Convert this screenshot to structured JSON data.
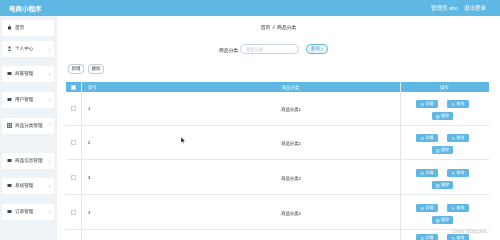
{
  "header": {
    "title": "电商小程序",
    "admin_text": "管理员 abo",
    "logout_label": "退出登录"
  },
  "sidebar": {
    "items": [
      {
        "label": "首页",
        "icon": "home-icon"
      },
      {
        "label": "个人中心",
        "icon": "user-icon"
      },
      {
        "label": "商家管理",
        "icon": "store-icon"
      },
      {
        "label": "用户管理",
        "icon": "users-icon"
      },
      {
        "label": "商品分类管理",
        "icon": "category-icon"
      },
      {
        "label": "商品信息管理",
        "icon": "goods-icon"
      },
      {
        "label": "系统管理",
        "icon": "settings-icon"
      },
      {
        "label": "订单管理",
        "icon": "order-icon"
      }
    ],
    "active_sub": "商品分类"
  },
  "breadcrumb": {
    "home": "首页",
    "sep": "//",
    "current": "商品分类"
  },
  "search": {
    "label": "商品分类",
    "placeholder": "商品分类",
    "button_label": "查询"
  },
  "toolbar": {
    "add_label": "新增",
    "delete_label": "删除"
  },
  "table": {
    "headers": {
      "index": "索引",
      "name": "商品分类",
      "ops": "操作"
    },
    "rows": [
      {
        "index": "1",
        "name": "商品分类1"
      },
      {
        "index": "2",
        "name": "商品分类2"
      },
      {
        "index": "3",
        "name": "商品分类3"
      },
      {
        "index": "4",
        "name": "商品分类4"
      }
    ],
    "actions": {
      "detail": "详情",
      "edit": "修改",
      "delete": "删除"
    }
  },
  "watermark": "CSDN @QQ1305..",
  "colors": {
    "accent": "#5fb7e3",
    "background": "#eef3f7"
  }
}
